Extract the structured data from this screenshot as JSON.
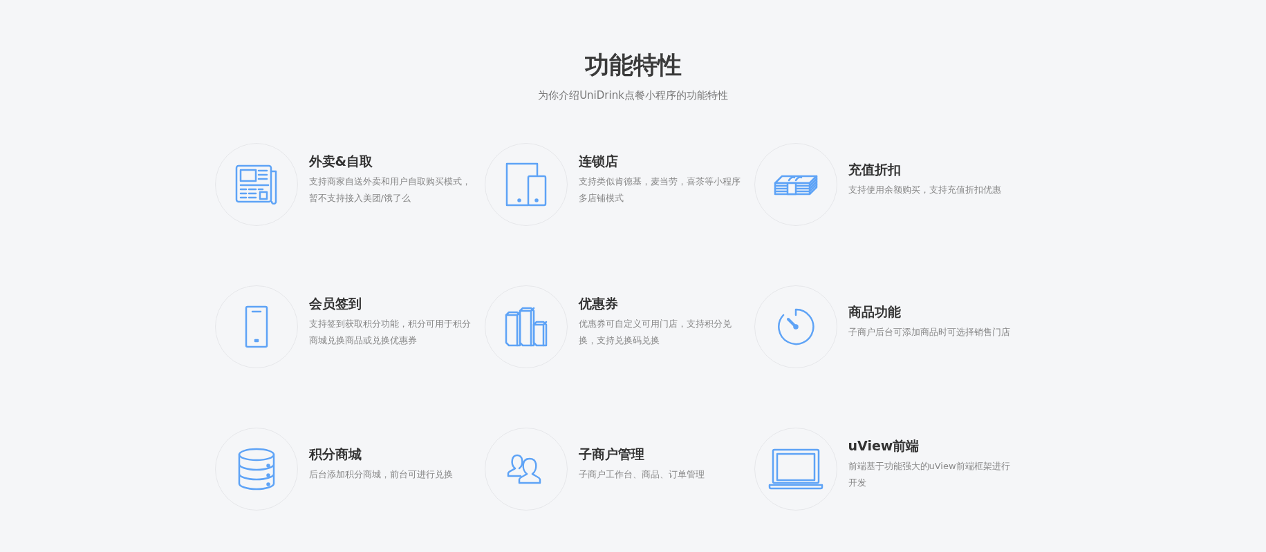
{
  "heading": {
    "title": "功能特性",
    "subtitle": "为你介绍UniDrink点餐小程序的功能特性"
  },
  "features": [
    {
      "title": "外卖&自取",
      "description": "支持商家自送外卖和用户自取购买模式，暂不支持接入美团/饿了么"
    },
    {
      "title": "连锁店",
      "description": "支持类似肯德基，麦当劳，喜茶等小程序多店铺模式"
    },
    {
      "title": "充值折扣",
      "description": "支持使用余额购买，支持充值折扣优惠"
    },
    {
      "title": "会员签到",
      "description": "支持签到获取积分功能，积分可用于积分商城兑换商品或兑换优惠券"
    },
    {
      "title": "优惠券",
      "description": "优惠券可自定义可用门店，支持积分兑换，支持兑换码兑换"
    },
    {
      "title": "商品功能",
      "description": "子商户后台可添加商品时可选择销售门店"
    },
    {
      "title": "积分商城",
      "description": "后台添加积分商城，前台可进行兑换"
    },
    {
      "title": "子商户管理",
      "description": "子商户工作台、商品、订单管理"
    },
    {
      "title": "uView前端",
      "description": "前端基于功能强大的uView前端框架进行开发"
    }
  ]
}
